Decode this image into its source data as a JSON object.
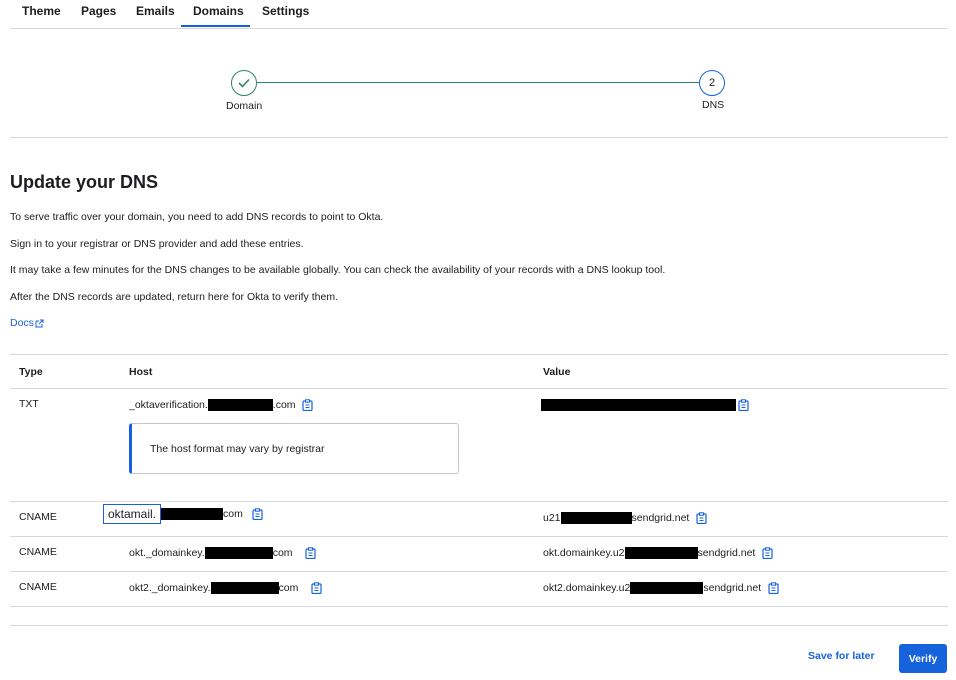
{
  "tabs": [
    {
      "label": "Theme",
      "active": false
    },
    {
      "label": "Pages",
      "active": false
    },
    {
      "label": "Emails",
      "active": false
    },
    {
      "label": "Domains",
      "active": true
    },
    {
      "label": "Settings",
      "active": false
    }
  ],
  "stepper": {
    "steps": [
      {
        "label": "Domain",
        "state": "complete",
        "icon": "check-icon"
      },
      {
        "label": "DNS",
        "number": "2",
        "state": "current"
      }
    ],
    "complete_color": "#2a8a66",
    "current_color": "#1662dd"
  },
  "main": {
    "title": "Update your DNS",
    "paragraphs": [
      "To serve traffic over your domain, you need to add DNS records to point to Okta.",
      "Sign in to your registrar or DNS provider and add these entries.",
      "It may take a few minutes for the DNS changes to be available globally. You can check the availability of your records with a DNS lookup tool.",
      "After the DNS records are updated, return here for Okta to verify them."
    ],
    "docs_link": "Docs",
    "docs_icon": "external-link-icon"
  },
  "table": {
    "headers": {
      "type": "Type",
      "host": "Host",
      "value": "Value"
    },
    "rows": [
      {
        "type": "TXT",
        "host_prefix": "_oktaverification.",
        "host_suffix": ".com",
        "value_prefix": "",
        "value_suffix": "",
        "note": "The host format may vary by registrar"
      },
      {
        "type": "CNAME",
        "host_prefix": "oktamail.",
        "host_suffix": "com",
        "value_prefix": "u21",
        "value_suffix": "sendgrid.net"
      },
      {
        "type": "CNAME",
        "host_prefix": "okt._domainkey.",
        "host_suffix": "com",
        "value_prefix": "okt.domainkey.u2",
        "value_suffix": "sendgrid.net"
      },
      {
        "type": "CNAME",
        "host_prefix": "okt2._domainkey.",
        "host_suffix": "com",
        "value_prefix": "okt2.domainkey.u2",
        "value_suffix": "sendgrid.net"
      }
    ],
    "copy_icon": "clipboard-copy-icon",
    "redaction_color": "#000000"
  },
  "footer": {
    "save_label": "Save for later",
    "verify_label": "Verify"
  },
  "colors": {
    "accent": "#1662dd",
    "divider": "#d7d7dc"
  }
}
